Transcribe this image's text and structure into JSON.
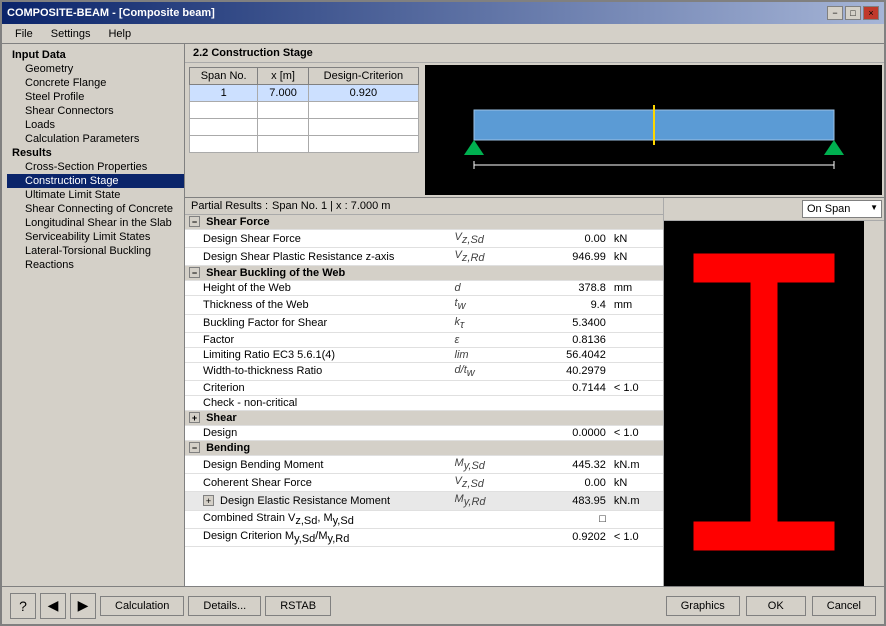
{
  "window": {
    "title": "COMPOSITE-BEAM - [Composite beam]",
    "close": "×",
    "minimize": "−",
    "maximize": "□"
  },
  "menu": {
    "items": [
      "File",
      "Settings",
      "Help"
    ]
  },
  "left_panel": {
    "input_data_label": "Input Data",
    "input_items": [
      "Geometry",
      "Concrete Flange",
      "Steel Profile",
      "Shear Connectors",
      "Loads",
      "Calculation Parameters"
    ],
    "results_label": "Results",
    "result_items": [
      "Cross-Section Properties",
      "Construction Stage",
      "Ultimate Limit State",
      "Shear Connecting of Concrete",
      "Longitudinal Shear in the Slab",
      "Serviceability Limit States",
      "Lateral-Torsional Buckling",
      "Reactions"
    ]
  },
  "section_title": "2.2 Construction Stage",
  "span_table": {
    "headers": [
      "Span No.",
      "x [m]",
      "Design-Criterion"
    ],
    "rows": [
      {
        "span": "1",
        "x": "7.000",
        "criterion": "0.920"
      }
    ]
  },
  "partial_results": {
    "label": "Partial Results :",
    "span_info": "Span No. 1 | x : 7.000 m"
  },
  "on_span_dropdown": "On Span",
  "results_rows": [
    {
      "type": "group",
      "expand": "−",
      "label": "Shear Force",
      "symbol": "",
      "value": "",
      "unit": ""
    },
    {
      "type": "data",
      "indent": 1,
      "label": "Design Shear Force",
      "symbol": "Vz,Sd",
      "value": "0.00",
      "unit": "kN"
    },
    {
      "type": "data",
      "indent": 1,
      "label": "Design Shear Plastic Resistance z-axis",
      "symbol": "Vz,Rd",
      "value": "946.99",
      "unit": "kN"
    },
    {
      "type": "group",
      "expand": "−",
      "label": "Shear Buckling of the Web",
      "symbol": "",
      "value": "",
      "unit": ""
    },
    {
      "type": "data",
      "indent": 1,
      "label": "Height of the Web",
      "symbol": "d",
      "value": "378.8",
      "unit": "mm"
    },
    {
      "type": "data",
      "indent": 1,
      "label": "Thickness of the Web",
      "symbol": "tw",
      "value": "9.4",
      "unit": "mm"
    },
    {
      "type": "data",
      "indent": 1,
      "label": "Buckling Factor for Shear",
      "symbol": "kτ",
      "value": "5.3400",
      "unit": ""
    },
    {
      "type": "data",
      "indent": 1,
      "label": "Factor",
      "symbol": "ε",
      "value": "0.8136",
      "unit": ""
    },
    {
      "type": "data",
      "indent": 1,
      "label": "Limiting Ratio EC3 5.6.1(4)",
      "symbol": "lim",
      "value": "56.4042",
      "unit": ""
    },
    {
      "type": "data",
      "indent": 1,
      "label": "Width-to-thickness Ratio",
      "symbol": "d/tw",
      "value": "40.2979",
      "unit": ""
    },
    {
      "type": "data",
      "indent": 1,
      "label": "Criterion",
      "symbol": "",
      "value": "0.7144",
      "unit": "< 1.0"
    },
    {
      "type": "data",
      "indent": 1,
      "label": "Check - non-critical",
      "symbol": "",
      "value": "",
      "unit": ""
    },
    {
      "type": "group",
      "expand": "+",
      "label": "Shear",
      "symbol": "",
      "value": "",
      "unit": ""
    },
    {
      "type": "data",
      "indent": 1,
      "label": "Design",
      "symbol": "",
      "value": "0.0000",
      "unit": "< 1.0"
    },
    {
      "type": "group",
      "expand": "−",
      "label": "Bending",
      "symbol": "",
      "value": "",
      "unit": ""
    },
    {
      "type": "data",
      "indent": 1,
      "label": "Design Bending Moment",
      "symbol": "My,Sd",
      "value": "445.32",
      "unit": "kN.m"
    },
    {
      "type": "data",
      "indent": 1,
      "label": "Coherent Shear Force",
      "symbol": "Vz,Sd",
      "value": "0.00",
      "unit": "kN"
    },
    {
      "type": "group2",
      "expand": "+",
      "indent": 1,
      "label": "Design Elastic Resistance Moment",
      "symbol": "My,Rd",
      "value": "483.95",
      "unit": "kN.m"
    },
    {
      "type": "data",
      "indent": 1,
      "label": "Combined Strain Vz,Sd, My,Sd",
      "symbol": "",
      "value": "□",
      "unit": ""
    },
    {
      "type": "data",
      "indent": 1,
      "label": "Design Criterion My,Sd/My,Rd",
      "symbol": "",
      "value": "0.9202",
      "unit": "< 1.0"
    }
  ],
  "footer": {
    "calculation_btn": "Calculation",
    "details_btn": "Details...",
    "rstab_btn": "RSTAB",
    "graphics_btn": "Graphics",
    "ok_btn": "OK",
    "cancel_btn": "Cancel"
  }
}
